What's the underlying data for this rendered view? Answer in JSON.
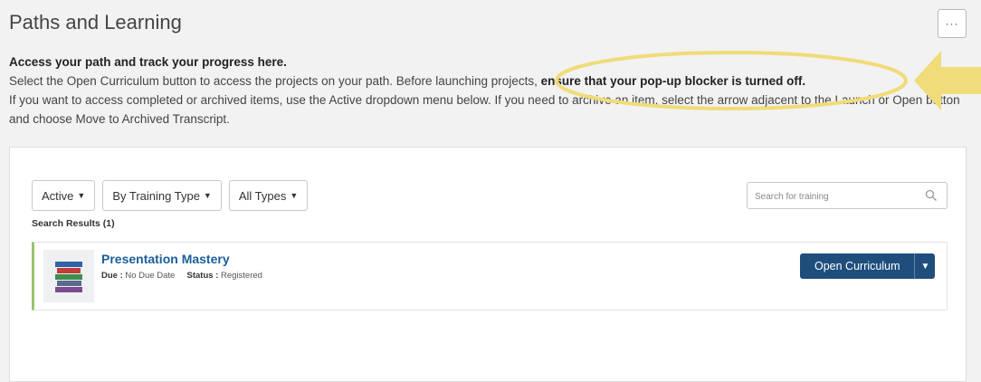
{
  "page": {
    "title": "Paths and Learning",
    "more_label": "···"
  },
  "intro": {
    "heading": "Access your path and track your progress here.",
    "line1_start": "Select the Open Curriculum button to access the projects on your path. Before launching projects, ",
    "line1_bold": "ensure that your pop-up blocker is turned off.",
    "line2": "If you want to access completed or archived items, use the Active dropdown menu below. If you need to archive an item, select the arrow adjacent to the Launch or Open button and choose Move to Archived Transcript."
  },
  "filters": {
    "status": "Active",
    "training_type": "By Training Type",
    "types": "All Types"
  },
  "search": {
    "placeholder": "Search for training"
  },
  "results": {
    "label": "Search Results (1)"
  },
  "items": [
    {
      "title": "Presentation Mastery",
      "due_label": "Due :",
      "due_value": "No Due Date",
      "status_label": "Status :",
      "status_value": "Registered",
      "action": "Open Curriculum"
    }
  ],
  "colors": {
    "highlight": "#f0dc78",
    "primary_button": "#1f4e7d",
    "item_accent": "#9bc26e",
    "link": "#1b5e9a"
  },
  "icons": {
    "more": "ellipsis-icon",
    "search": "search-icon",
    "caret": "caret-down-icon",
    "thumbnail": "books-icon",
    "highlight_arrow": "arrow-left-icon"
  }
}
